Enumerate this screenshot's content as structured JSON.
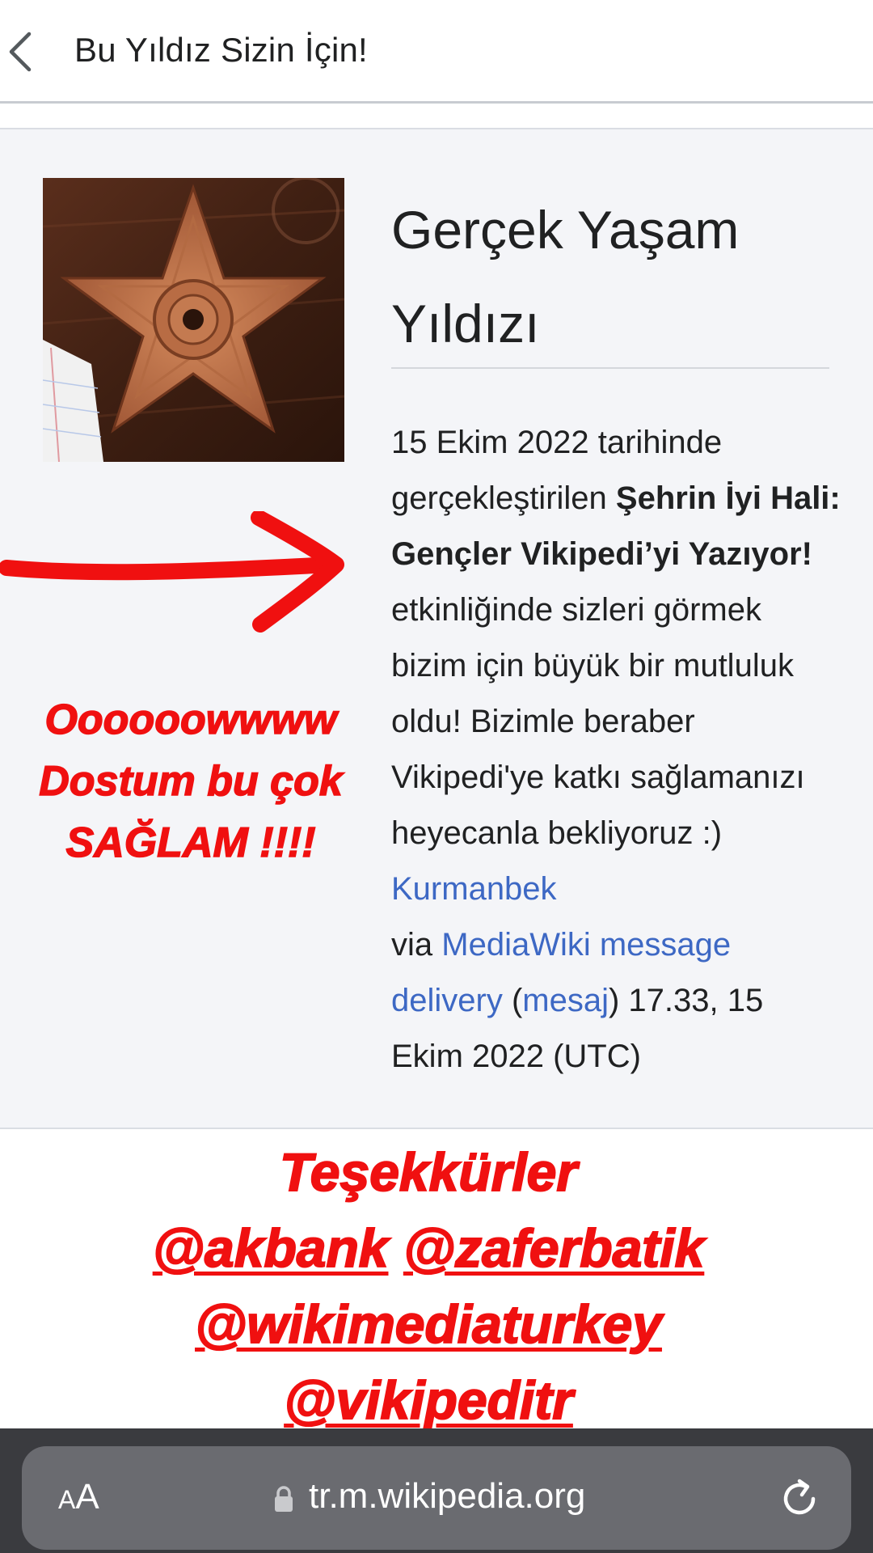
{
  "header": {
    "title": "Bu Yıldız Sizin İçin!"
  },
  "award": {
    "title_line1": "Gerçek Yaşam",
    "title_line2": "Yıldızı",
    "text_intro": "15 Ekim 2022 tarihinde gerçekleştirilen ",
    "event_name": "Şehrin İyi Hali: Gençler Vikipedi’yi Yazıyor!",
    "text_middle": " etkinliğinde sizleri görmek bizim için büyük bir mutluluk oldu! Bizimle beraber Vikipedi'ye katkı sağlamanızı heyecanla bekliyoruz :) ",
    "signature_user": "Kurmanbek",
    "via_text": "via ",
    "delivery_link": "MediaWiki message delivery",
    "paren_open": " (",
    "talk_link": "mesaj",
    "timestamp": ") 17.33, 15 Ekim 2022 (UTC)"
  },
  "annotations": {
    "reaction_line1": "Oooooowwww",
    "reaction_line2": "Dostum bu çok",
    "reaction_line3": "SAĞLAM !!!!",
    "thanks": "Teşekkürler",
    "mention_akbank": "@akbank",
    "mention_zaferbatik": "@zaferbatik",
    "mention_wikimediaturkey": "@wikimediaturkey",
    "mention_vikipeditr": "@vikipeditr"
  },
  "browser": {
    "text_size_small": "A",
    "text_size_large": "A",
    "url": "tr.m.wikipedia.org"
  },
  "colors": {
    "link": "#3d68c4",
    "annotation_red": "#f01010",
    "box_background": "#f4f5f8",
    "toolbar_background": "#3a3b3f"
  },
  "icons": [
    "back-chevron-icon",
    "barnstar-image",
    "red-arrow",
    "lock-icon",
    "reload-icon"
  ]
}
